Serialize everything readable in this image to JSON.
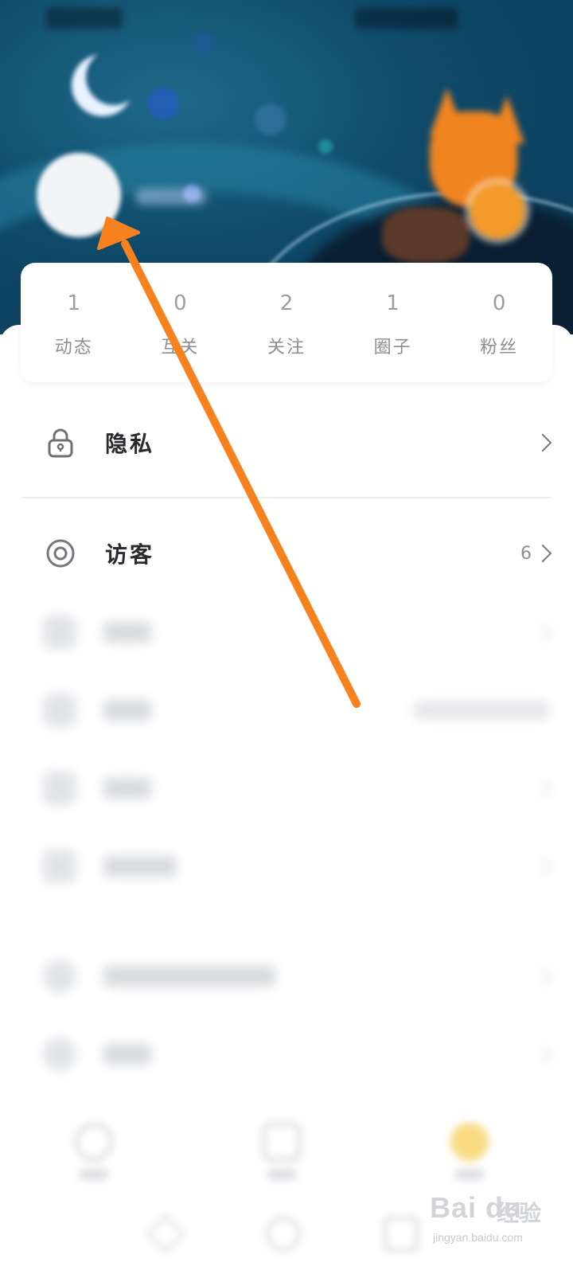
{
  "stats": [
    {
      "count": "1",
      "label": "动态"
    },
    {
      "count": "0",
      "label": "互关"
    },
    {
      "count": "2",
      "label": "关注"
    },
    {
      "count": "1",
      "label": "圈子"
    },
    {
      "count": "0",
      "label": "粉丝"
    }
  ],
  "menu": {
    "privacy": {
      "label": "隐私",
      "icon": "lock-icon"
    },
    "visitors": {
      "label": "访客",
      "count": "6",
      "icon": "eye-icon"
    }
  },
  "watermark": {
    "brand": "Bai du",
    "suffix": "经验",
    "url": "jingyan.baidu.com"
  },
  "colors": {
    "arrow": "#f7811c",
    "header": "#0f4a6a"
  }
}
